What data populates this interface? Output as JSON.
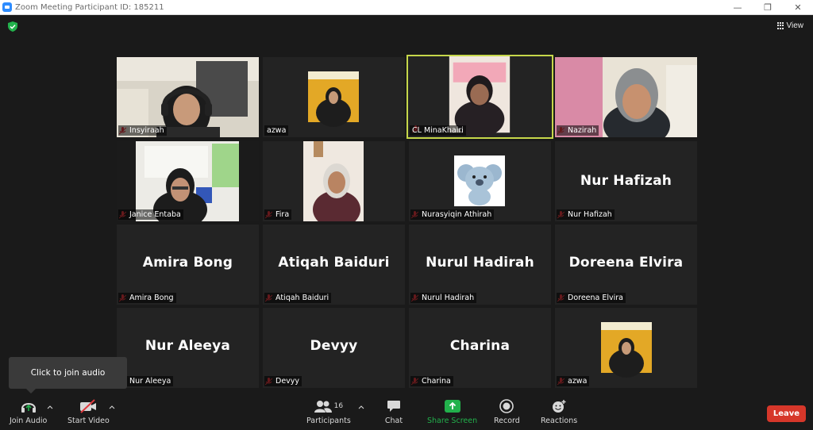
{
  "window": {
    "title": "Zoom Meeting Participant ID: 185211",
    "controls": [
      "—",
      "❐",
      "✕"
    ]
  },
  "view_label": "View",
  "tiles": [
    {
      "id": "insyiraah",
      "label": "Insyiraah",
      "big_name": "",
      "kind": "video"
    },
    {
      "id": "azwa-1",
      "label": "azwa",
      "big_name": "",
      "kind": "photo"
    },
    {
      "id": "cl-minakhairi",
      "label": "CL MinaKhairi",
      "big_name": "",
      "kind": "video",
      "active": true
    },
    {
      "id": "nazirah",
      "label": "Nazirah",
      "big_name": "",
      "kind": "video"
    },
    {
      "id": "janice-entaba",
      "label": "Janice Entaba",
      "big_name": "",
      "kind": "video"
    },
    {
      "id": "fira",
      "label": "Fira",
      "big_name": "",
      "kind": "video"
    },
    {
      "id": "nurasyiqin-athirah",
      "label": "Nurasyiqin Athirah",
      "big_name": "",
      "kind": "photo"
    },
    {
      "id": "nur-hafizah",
      "label": "Nur Hafizah",
      "big_name": "Nur Hafizah",
      "kind": "name"
    },
    {
      "id": "amira-bong",
      "label": "Amira Bong",
      "big_name": "Amira Bong",
      "kind": "name"
    },
    {
      "id": "atiqah-baiduri",
      "label": "Atiqah Baiduri",
      "big_name": "Atiqah Baiduri",
      "kind": "name"
    },
    {
      "id": "nurul-hadirah",
      "label": "Nurul Hadirah",
      "big_name": "Nurul Hadirah",
      "kind": "name"
    },
    {
      "id": "doreena-elvira",
      "label": "Doreena Elvira",
      "big_name": "Doreena Elvira",
      "kind": "name"
    },
    {
      "id": "nur-aleeya",
      "label": "Nur Aleeya",
      "big_name": "Nur Aleeya",
      "kind": "name"
    },
    {
      "id": "devyy",
      "label": "Devyy",
      "big_name": "Devyy",
      "kind": "name"
    },
    {
      "id": "charina",
      "label": "Charina",
      "big_name": "Charina",
      "kind": "name"
    },
    {
      "id": "azwa-2",
      "label": "azwa",
      "big_name": "",
      "kind": "photo"
    }
  ],
  "tooltip": "Click to join audio",
  "toolbar": {
    "join_audio": "Join Audio",
    "start_video": "Start Video",
    "participants": "Participants",
    "participants_count": "16",
    "chat": "Chat",
    "share_screen": "Share Screen",
    "record": "Record",
    "reactions": "Reactions",
    "leave": "Leave"
  },
  "colors": {
    "background": "#1a1a1a",
    "tile": "#232323",
    "active_speaker": "#c6d74a",
    "share_green": "#22b14c",
    "leave_red": "#d6372a",
    "mute_red": "#e0393e"
  }
}
